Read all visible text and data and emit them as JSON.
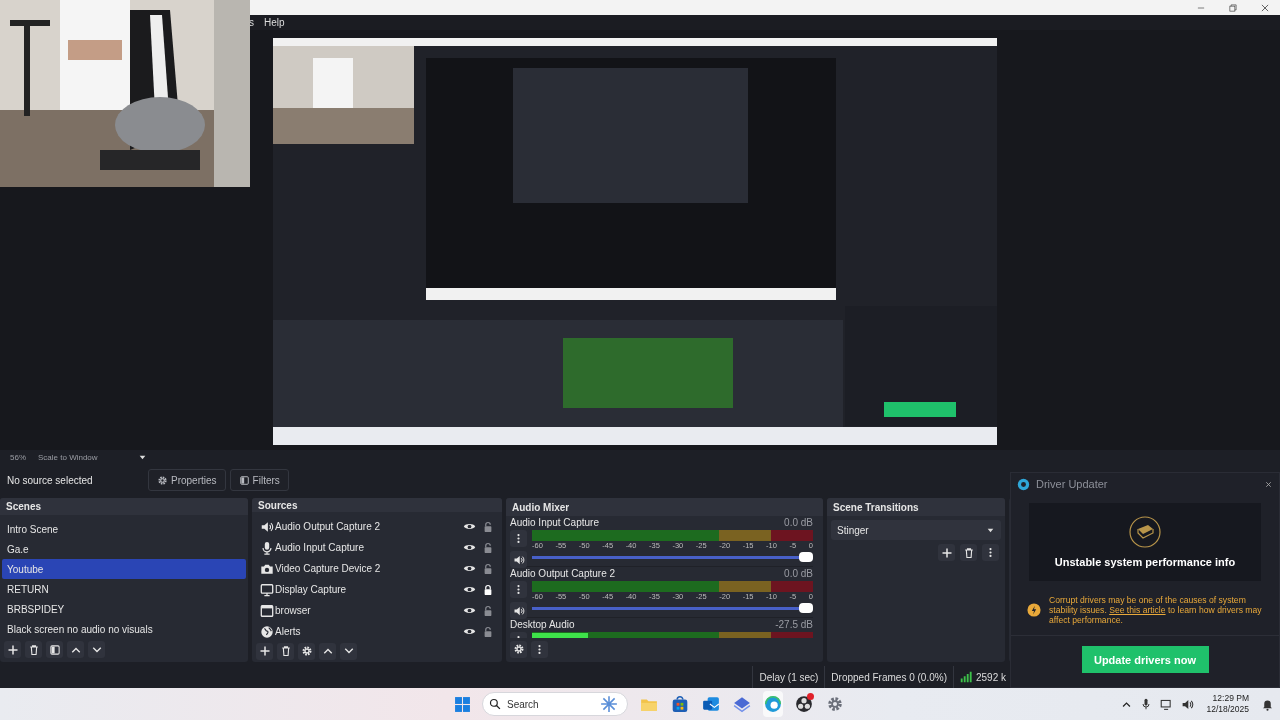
{
  "menu_items": [
    "s",
    "Help"
  ],
  "zoom_bar": {
    "zoom": "56%",
    "scale_mode": "Scale to Window"
  },
  "source_toolbar": {
    "status": "No source selected",
    "buttons": [
      {
        "label": "Properties",
        "kind": "gear"
      },
      {
        "label": "Filters",
        "kind": "filter"
      }
    ]
  },
  "scenes": {
    "title": "Scenes",
    "items": [
      {
        "name": "Intro Scene",
        "selected": false
      },
      {
        "name": "Ga.e",
        "selected": false
      },
      {
        "name": "Youtube",
        "selected": true
      },
      {
        "name": "RETURN",
        "selected": false
      },
      {
        "name": "BRBSPIDEY",
        "selected": false
      },
      {
        "name": "Black screen no audio no visuals",
        "selected": false
      }
    ]
  },
  "sources": {
    "title": "Sources",
    "items": [
      {
        "name": "Audio Output Capture 2",
        "kind": "speaker",
        "visible": true,
        "locked": false
      },
      {
        "name": "Audio Input Capture",
        "kind": "mic",
        "visible": true,
        "locked": false
      },
      {
        "name": "Video Capture Device 2",
        "kind": "camera",
        "visible": true,
        "locked": false
      },
      {
        "name": "Display Capture",
        "kind": "monitor",
        "visible": true,
        "locked": true
      },
      {
        "name": "browser",
        "kind": "browser",
        "visible": true,
        "locked": false
      },
      {
        "name": "Alerts",
        "kind": "globe",
        "visible": true,
        "locked": false
      }
    ]
  },
  "audio_mixer": {
    "title": "Audio Mixer",
    "channels": [
      {
        "name": "Audio Input Capture",
        "reading": "0.0 dB",
        "volume": {
          "level": 1
        },
        "ticks": [
          "-60",
          "-55",
          "-50",
          "-45",
          "-40",
          "-35",
          "-30",
          "-25",
          "-20",
          "-15",
          "-10",
          "-5",
          "0"
        ]
      },
      {
        "name": "Audio Output Capture 2",
        "reading": "0.0 dB",
        "volume": {
          "level": 1
        },
        "ticks": [
          "-60",
          "-55",
          "-50",
          "-45",
          "-40",
          "-35",
          "-30",
          "-25",
          "-20",
          "-15",
          "-10",
          "-5",
          "0"
        ]
      },
      {
        "name": "Desktop Audio",
        "reading": "-27.5 dB",
        "meter": {
          "level": 0.2
        }
      }
    ]
  },
  "scene_transitions": {
    "title": "Scene Transitions",
    "selected": "Stinger"
  },
  "status_bar": {
    "delay": "Delay (1 sec)",
    "dropped": "Dropped Frames 0 (0.0%)",
    "bitrate": "2592 k"
  },
  "driver_updater": {
    "title": "Driver Updater",
    "heading": "Unstable system performance info",
    "message": {
      "before": "Corrupt drivers may be one of the causes of system stability issues.",
      "link": "See this article",
      "after": "to learn how drivers may affect performance."
    },
    "button": "Update drivers now"
  },
  "taskbar": {
    "search": {
      "placeholder": "Search"
    },
    "time": "12:29 PM",
    "date": "12/18/2025"
  }
}
